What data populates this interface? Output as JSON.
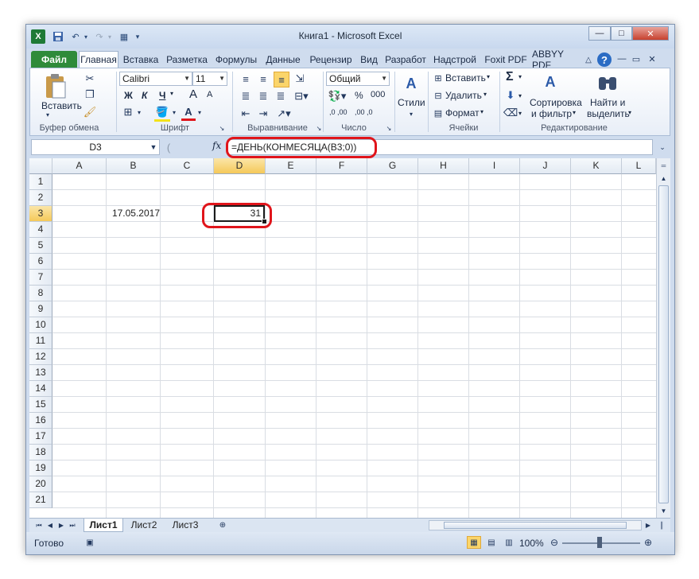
{
  "window": {
    "title": "Книга1 - Microsoft Excel",
    "controls": [
      "—",
      "□",
      "✕"
    ]
  },
  "quick_access": {
    "icons": [
      "excel-logo-icon",
      "save-icon",
      "undo-icon",
      "redo-icon",
      "form-icon",
      "customize-icon"
    ]
  },
  "ribbon_tabs": [
    "Файл",
    "Главная",
    "Вставка",
    "Разметка",
    "Формулы",
    "Данные",
    "Рецензир",
    "Вид",
    "Разработ",
    "Надстрой",
    "Foxit PDF",
    "ABBYY PDF"
  ],
  "ribbon": {
    "clipboard": {
      "paste": "Вставить",
      "label": "Буфер обмена"
    },
    "font": {
      "name": "Calibri",
      "size": "11",
      "bold": "Ж",
      "italic": "К",
      "underline": "Ч",
      "grow": "A",
      "shrink": "A",
      "label": "Шрифт"
    },
    "alignment": {
      "label": "Выравнивание"
    },
    "number": {
      "format": "Общий",
      "percent": "%",
      "thousands": "000",
      "inc": ",0 ,00",
      "dec": ",00 ,0",
      "label": "Число"
    },
    "styles": {
      "button": "Стили"
    },
    "cells": {
      "insert": "Вставить",
      "delete": "Удалить",
      "format": "Формат",
      "label": "Ячейки"
    },
    "editing": {
      "sum": "Σ",
      "sort_line1": "Сортировка",
      "sort_line2": "и фильтр",
      "find_line1": "Найти и",
      "find_line2": "выделить",
      "label": "Редактирование"
    }
  },
  "formula_bar": {
    "name_box": "D3",
    "fx": "fx",
    "formula": "=ДЕНЬ(КОНМЕСЯЦА(B3;0))"
  },
  "grid": {
    "columns": [
      "A",
      "B",
      "C",
      "D",
      "E",
      "F",
      "G",
      "H",
      "I",
      "J",
      "K",
      "L"
    ],
    "rows": [
      "1",
      "2",
      "3",
      "4",
      "5",
      "6",
      "7",
      "8",
      "9",
      "10",
      "11",
      "12",
      "13",
      "14",
      "15",
      "16",
      "17",
      "18",
      "19",
      "20",
      "21"
    ],
    "cells": {
      "B3": "17.05.2017",
      "D3": "31"
    },
    "selected_cell": "D3"
  },
  "sheets": [
    "Лист1",
    "Лист2",
    "Лист3"
  ],
  "status": {
    "ready": "Готово",
    "zoom": "100%"
  },
  "colors": {
    "file_tab": "#2f8b3a",
    "highlight": "#e0151b",
    "selected_header": "#f5c95a"
  }
}
